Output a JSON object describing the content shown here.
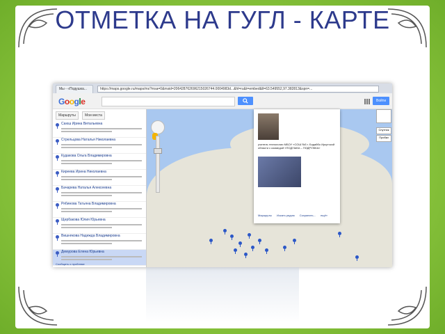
{
  "slide": {
    "title": "ОТМЕТКА НА ГУГЛ - КАРТЕ",
    "colors": {
      "background": "#8cc63f",
      "title": "#2d3a8c",
      "frame": "#ffffff"
    }
  },
  "browser": {
    "tabs": [
      "Мы - «Подушка...",
      "Карта участников...×"
    ],
    "url": "https://maps.google.ru/maps/ms?msa=0&msid=206428762696215026744.0004983d...&hl=ru&t=embed&ll=63.549552,97.382813&spn=..."
  },
  "google": {
    "logo": "Google",
    "search_icon": "search-icon",
    "signin_label": "Войти"
  },
  "sidebar": {
    "buttons": [
      "Маршруты",
      "Мои места"
    ],
    "items": [
      {
        "name": "Саюш Ирина Витальевна",
        "selected": false
      },
      {
        "name": "Стрельцова Наталья Николаевна",
        "selected": false
      },
      {
        "name": "Кудакова Ольга Владимировна",
        "selected": false
      },
      {
        "name": "Киреева Ирина Николаевна",
        "selected": false
      },
      {
        "name": "Бачарева Наталья Алексеевна",
        "selected": false
      },
      {
        "name": "Рябинова Татьяна Владимировна",
        "selected": false
      },
      {
        "name": "Щербакова Юлия Юрьевна",
        "selected": false
      },
      {
        "name": "Вишнякова Надежда Владимировна",
        "selected": false
      },
      {
        "name": "Демурова Елена Юрьевна",
        "selected": true
      }
    ],
    "footer": "Сообщить о проблеме"
  },
  "map": {
    "map_types": [
      "Спутник",
      "Пробки"
    ],
    "popup": {
      "text": "учитель технологии МБОУ «СОШ №3 г. Бодайбо Иркутской области с командой «ПОДУШКА – ПОДРУЖКА»",
      "links": [
        "Маршруты",
        "Искать рядом",
        "Сохранить...",
        "ещё»"
      ]
    }
  }
}
